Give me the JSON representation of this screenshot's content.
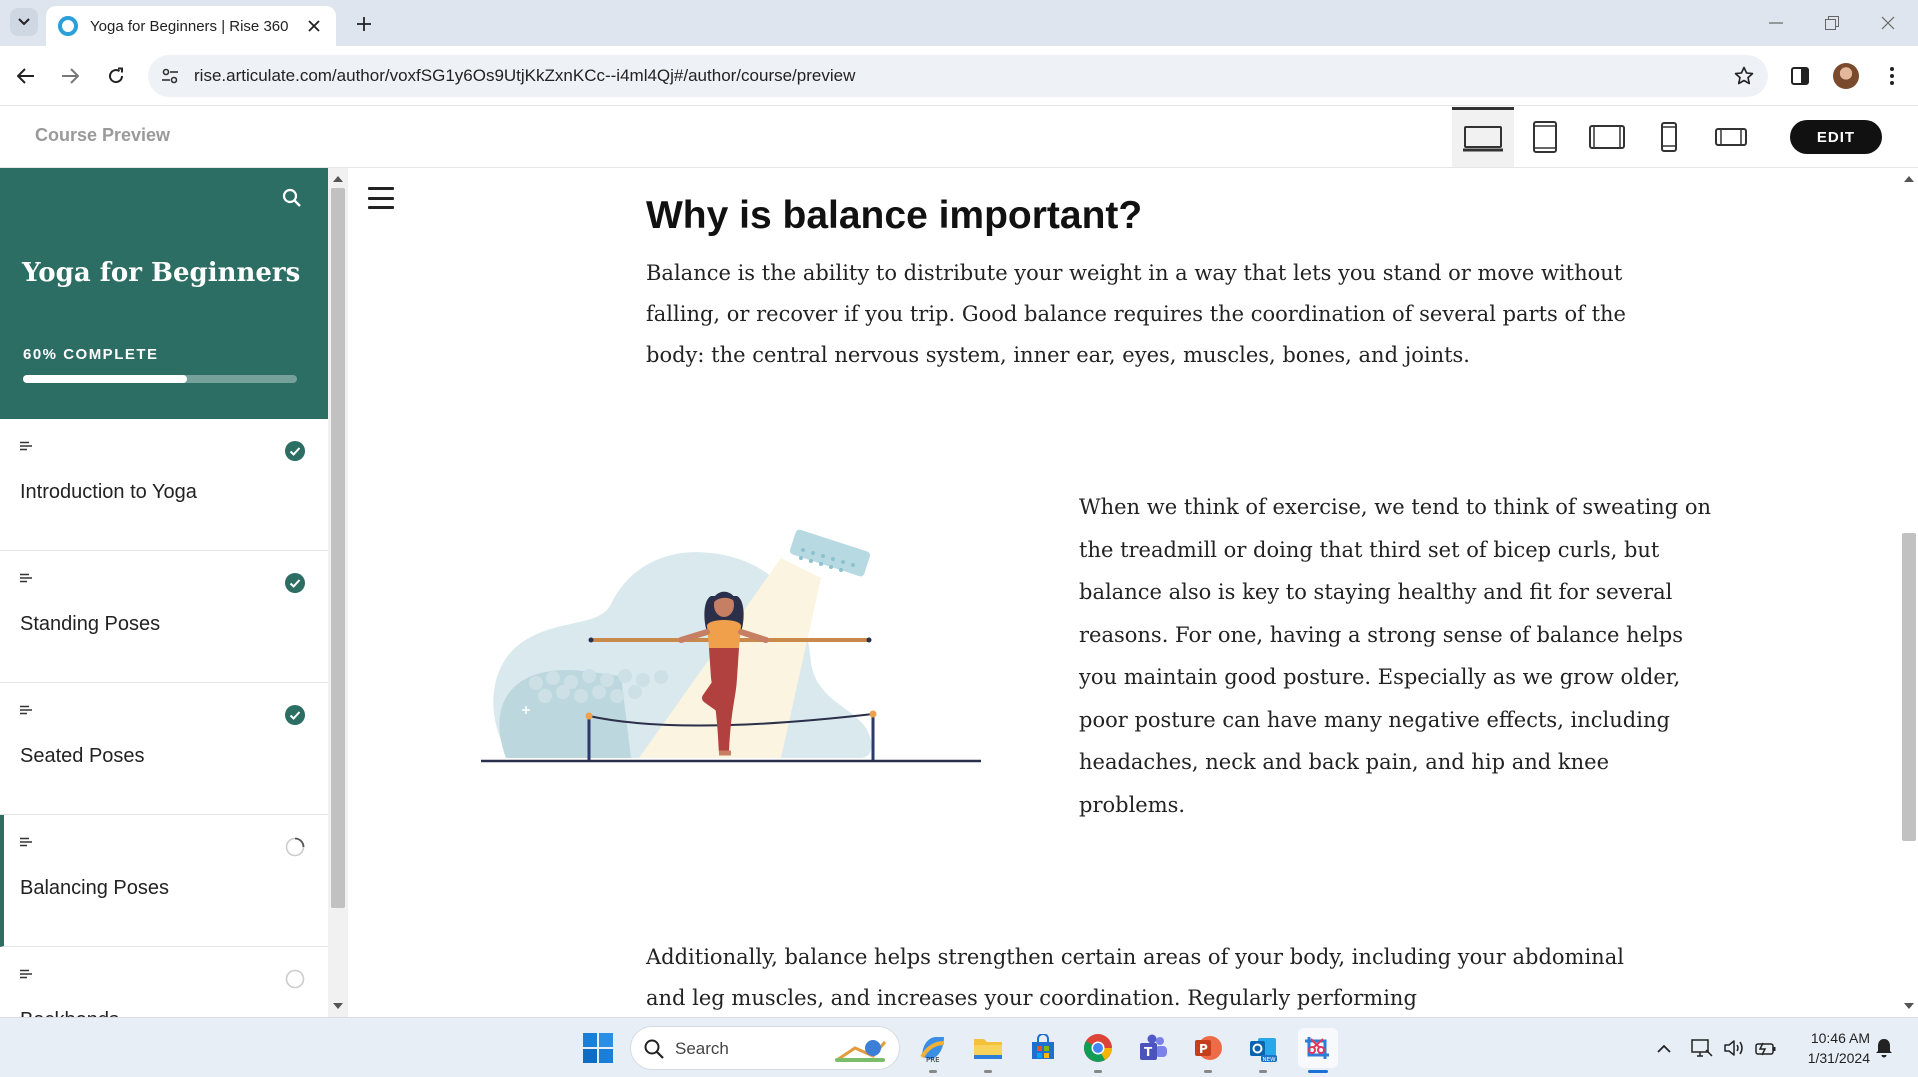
{
  "browser": {
    "tab_title": "Yoga for Beginners | Rise 360",
    "url": "rise.articulate.com/author/voxfSG1y6Os9UtjKkZxnKCc--i4ml4Qj#/author/course/preview"
  },
  "rise_header": {
    "title": "Course Preview",
    "devices": [
      "desktop-icon",
      "tablet-portrait-icon",
      "tablet-landscape-icon",
      "phone-portrait-icon",
      "phone-landscape-icon"
    ],
    "active_device": "desktop",
    "edit_label": "EDIT"
  },
  "sidebar": {
    "course_title": "Yoga for Beginners",
    "progress_label": "60% COMPLETE",
    "progress_percent": 60,
    "accent_color": "#2d6e64",
    "lessons": [
      {
        "label": "Introduction to Yoga",
        "status": "complete"
      },
      {
        "label": "Standing Poses",
        "status": "complete"
      },
      {
        "label": "Seated Poses",
        "status": "complete"
      },
      {
        "label": "Balancing Poses",
        "status": "in-progress"
      },
      {
        "label": "Backbends",
        "status": "not-started"
      }
    ]
  },
  "content": {
    "heading": "Why is balance important?",
    "paragraph1": "Balance is the ability to distribute your weight in a way that lets you stand or move without falling, or recover if you trip. Good balance requires the coordination of several parts of the body: the central nervous system, inner ear, eyes, muscles, bones, and joints.",
    "paragraph2": "When we think of exercise, we tend to think of sweating on the treadmill or doing that third set of bicep curls, but balance also is key to staying healthy and fit for several reasons. For one, having a strong sense of balance helps you maintain good posture. Especially as we grow older, poor posture can have many negative effects, including headaches, neck and back pain, and hip and knee problems.",
    "paragraph3": "Additionally, balance helps strengthen certain areas of your body, including your abdominal and leg muscles, and increases your coordination. Regularly performing"
  },
  "taskbar": {
    "search_placeholder": "Search",
    "time": "10:46 AM",
    "date": "1/31/2024"
  }
}
